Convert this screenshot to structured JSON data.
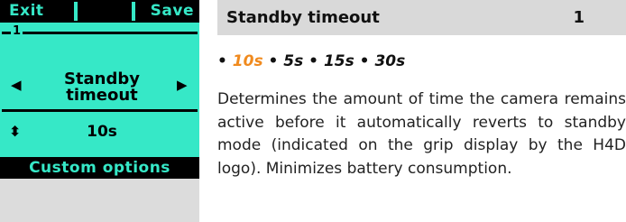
{
  "display": {
    "softkeys": {
      "left": "Exit",
      "right": "Save"
    },
    "page_number": "1",
    "parameter_name_line1": "Standby",
    "parameter_name_line2": "timeout",
    "parameter_value": "10s",
    "footer": "Custom options",
    "icons": {
      "left": "left-triangle-icon",
      "right": "right-triangle-icon",
      "updown": "up-down-arrows-icon"
    },
    "colors": {
      "lcd_background": "#36e8c7",
      "lcd_ink": "#000000"
    }
  },
  "section": {
    "title": "Standby timeout",
    "number": "1",
    "options": [
      {
        "label": "10s",
        "default": true
      },
      {
        "label": "5s",
        "default": false
      },
      {
        "label": "15s",
        "default": false
      },
      {
        "label": "30s",
        "default": false
      }
    ],
    "bullet": "•",
    "description": "Determines the amount of time the camera remains active before it automatically reverts to standby mode (indicated on the grip display by the H4D logo). Minimizes battery consumption.",
    "colors": {
      "default_option": "#f08a1e",
      "heading_bar": "#d9d9d9"
    }
  }
}
